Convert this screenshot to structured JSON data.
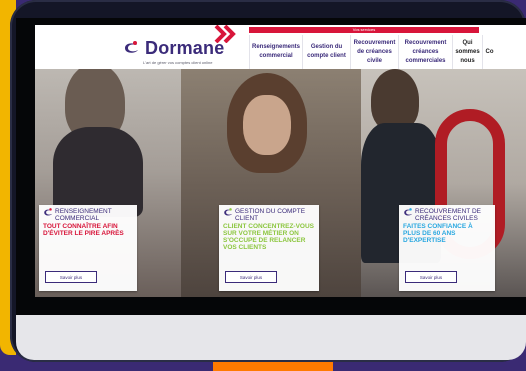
{
  "header": {
    "top_strip": "Vos services",
    "logo": {
      "name": "Dormane",
      "tagline": "L'art de gérer vos comptes client online"
    },
    "nav": [
      {
        "label": "Renseignements commercial"
      },
      {
        "label": "Gestion du compte client"
      },
      {
        "label": "Recouvrement de créances civile"
      },
      {
        "label": "Recouvrement créances commerciales"
      },
      {
        "label": "Qui sommes nous"
      },
      {
        "label": "Co"
      }
    ]
  },
  "panels": [
    {
      "title": "Renseignement commercial",
      "subtitle": "Tout connaître afin d'éviter le pire après",
      "button": "Savoir plus",
      "subtitle_color": "#d8153a"
    },
    {
      "title": "Gestion du compte client",
      "subtitle": "Client concentrez-vous sur votre métier on s'occupe de relancer vos clients",
      "button": "Savoir plus",
      "subtitle_color": "#8cc63f"
    },
    {
      "title": "Recouvrement de créances civiles",
      "subtitle": "Faites confiance à plus de 60 ans d'expertise",
      "button": "Savoir plus",
      "subtitle_color": "#29a8e0"
    }
  ],
  "colors": {
    "brand_purple": "#3b2b7a",
    "brand_red": "#d8153a",
    "background": "#3a2a73",
    "accent_yellow": "#f2b500",
    "accent_orange": "#ff7a00"
  }
}
